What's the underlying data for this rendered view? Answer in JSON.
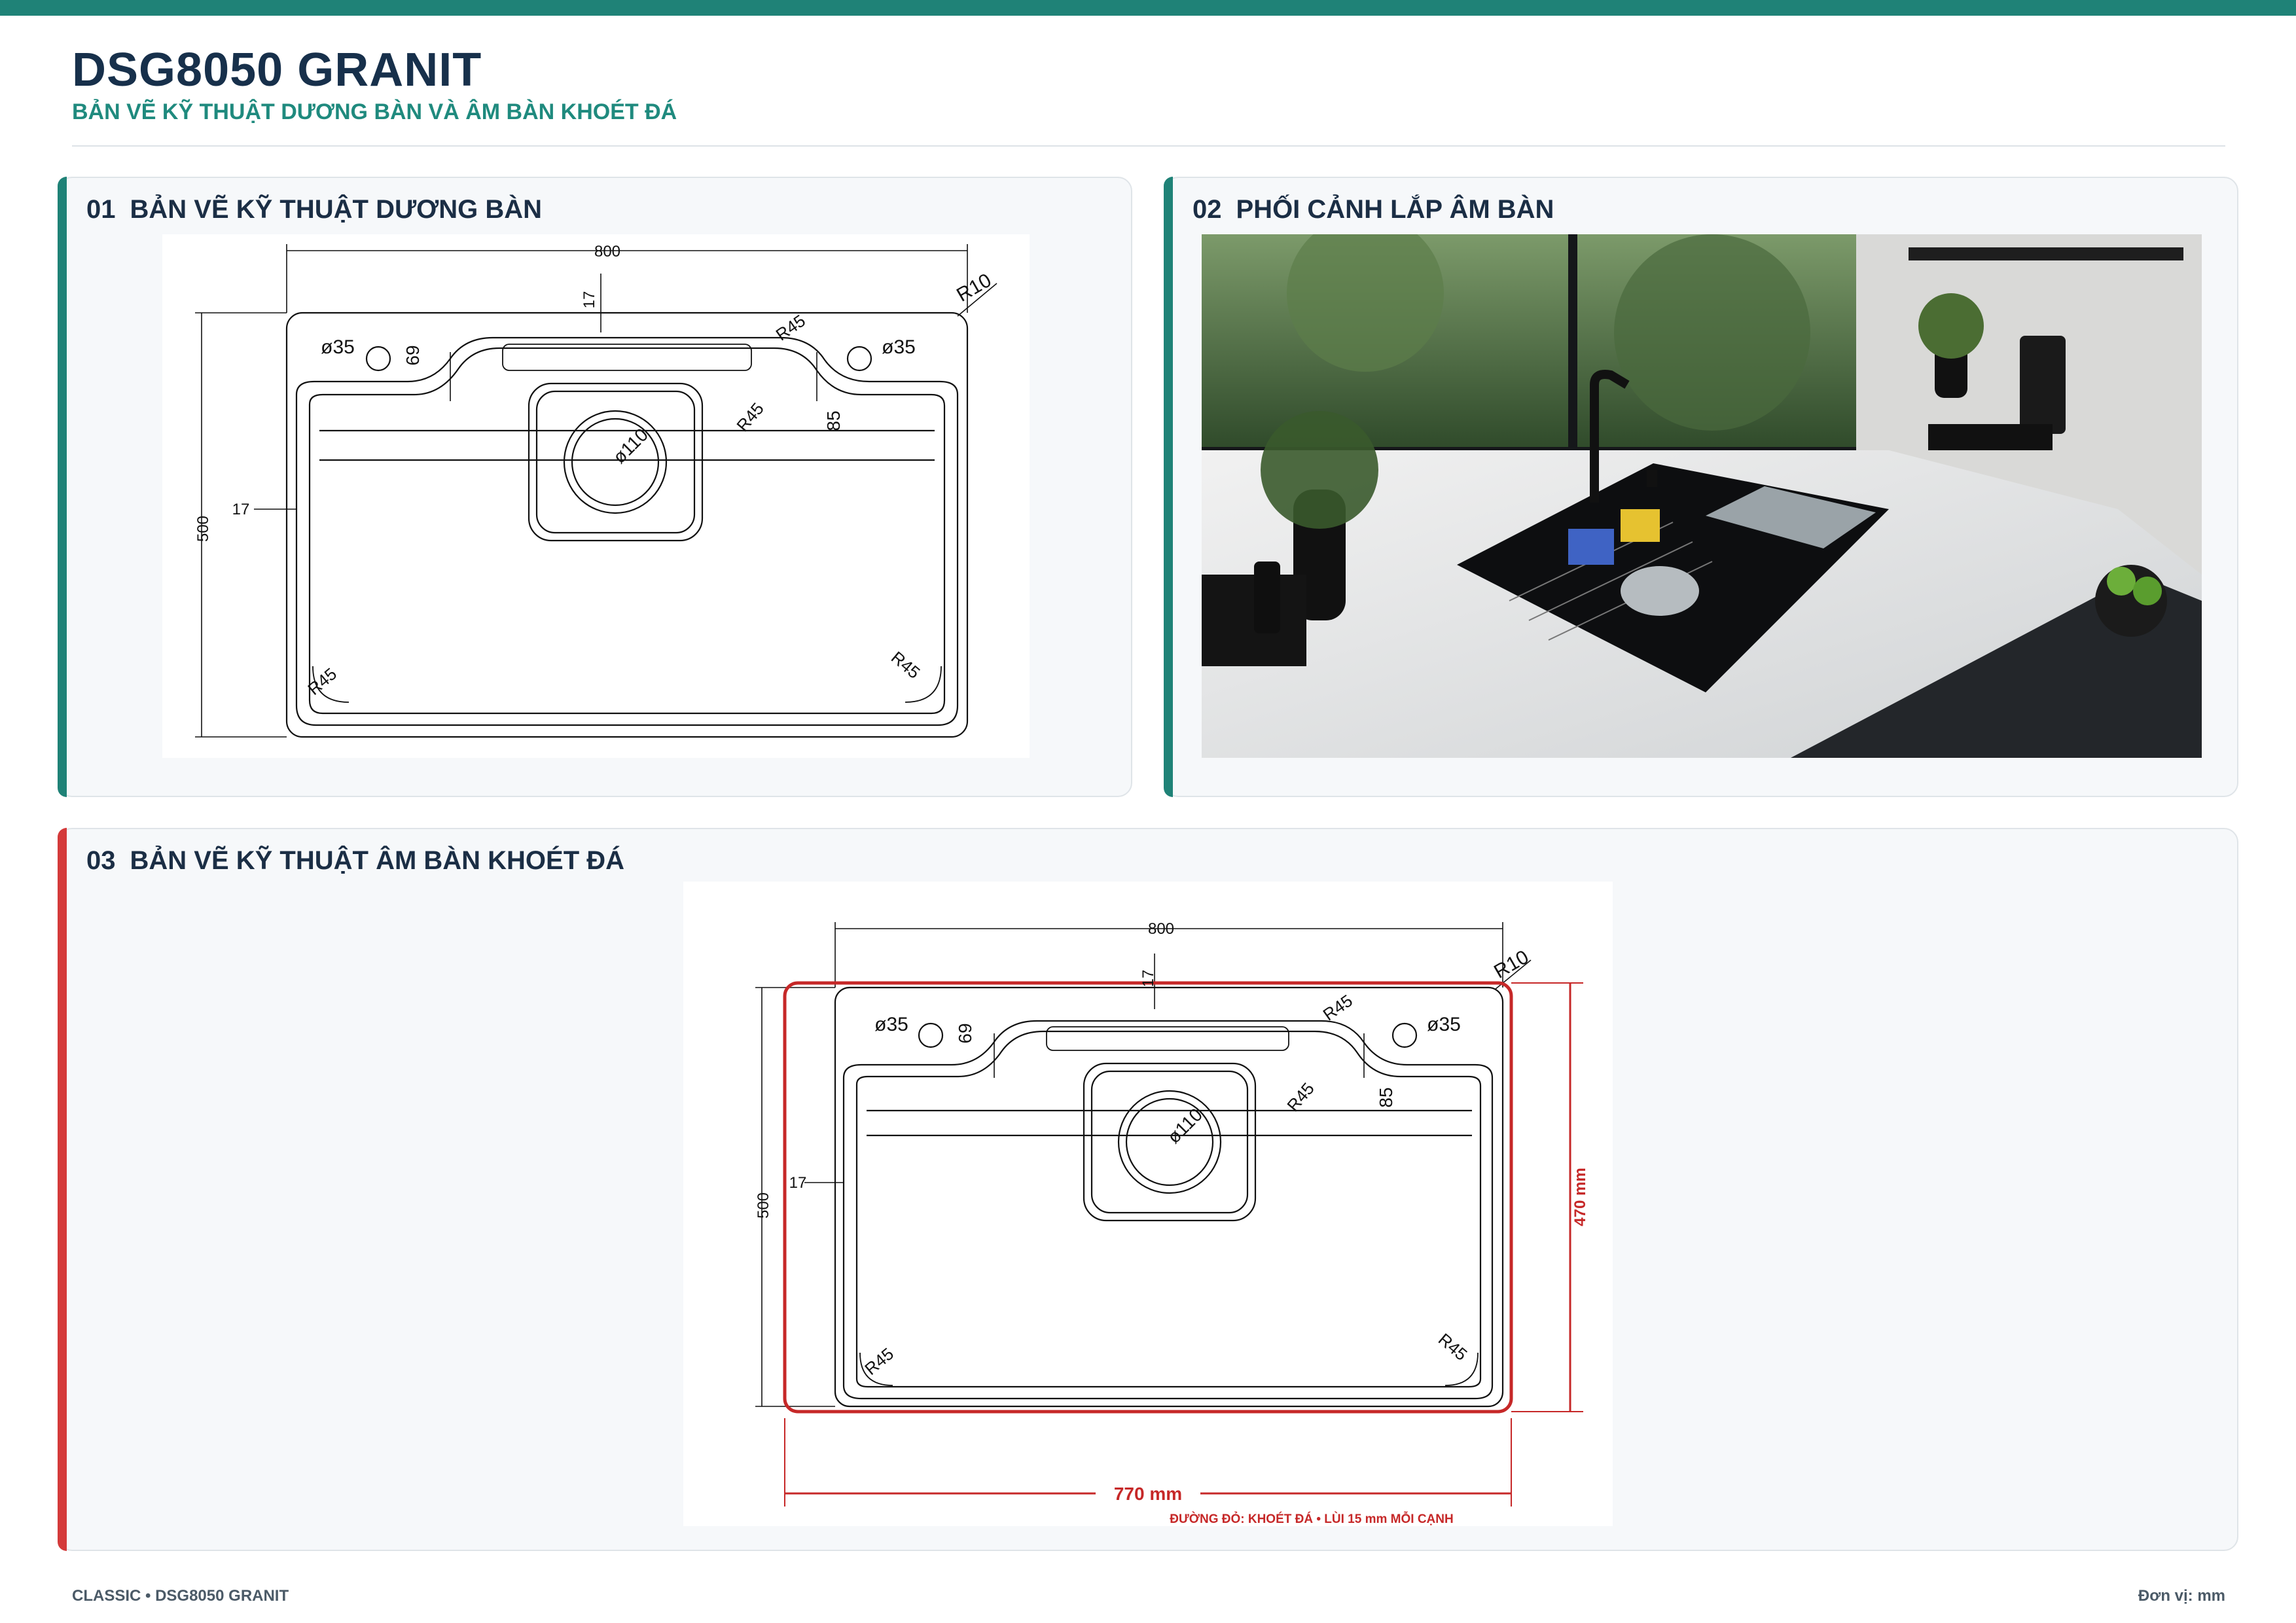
{
  "header": {
    "title": "DSG8050 GRANIT",
    "subtitle": "BẢN VẼ KỸ THUẬT DƯƠNG BÀN VÀ ÂM BÀN KHOÉT ĐÁ"
  },
  "panels": [
    {
      "num": "01",
      "title": "BẢN VẼ KỸ THUẬT DƯƠNG BÀN",
      "accent": "#1f8277"
    },
    {
      "num": "02",
      "title": "PHỐI CẢNH LẮP ÂM BÀN",
      "accent": "#1f8277"
    },
    {
      "num": "03",
      "title": "BẢN VẼ KỸ THUẬT ÂM BÀN KHOÉT ĐÁ",
      "accent": "#d43a3a"
    }
  ],
  "drawing_labels": {
    "width": "800",
    "height": "500",
    "edge": "17",
    "tap_hole": "ø35",
    "tap_offset": "69",
    "drain": "ø110",
    "corner_r10": "R10",
    "corner_r45": "R45",
    "step": "85"
  },
  "cutout": {
    "width": "770 mm",
    "height": "470 mm",
    "note": "ĐƯỜNG ĐỎ: KHOÉT ĐÁ • LÙI 15 mm MỖI CẠNH",
    "color": "#c62828"
  },
  "footer": {
    "left": "CLASSIC • DSG8050 GRANIT",
    "right": "Đơn vị: mm"
  }
}
